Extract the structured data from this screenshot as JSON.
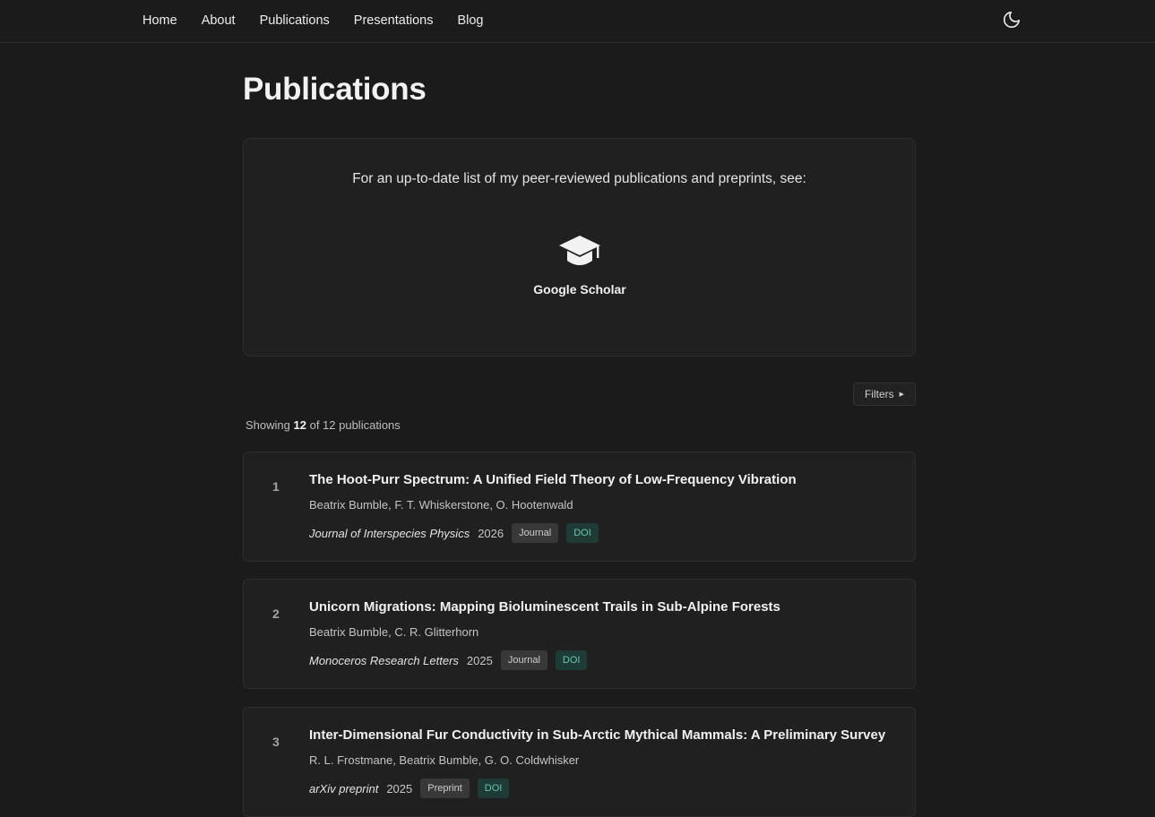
{
  "nav": {
    "items": [
      {
        "label": "Home"
      },
      {
        "label": "About"
      },
      {
        "label": "Publications"
      },
      {
        "label": "Presentations"
      },
      {
        "label": "Blog"
      }
    ],
    "theme_icon": "moon-icon"
  },
  "page": {
    "title": "Publications"
  },
  "scholar": {
    "text": "For an up-to-date list of my peer-reviewed publications and preprints, see:",
    "icon": "graduation-cap-icon",
    "label": "Google Scholar"
  },
  "filters": {
    "label": "Filters",
    "icon": "caret-right-icon"
  },
  "summary": {
    "prefix": "Showing",
    "shown": "12",
    "middle": "of 12 publications"
  },
  "publications": [
    {
      "number": "1",
      "title": "The Hoot-Purr Spectrum: A Unified Field Theory of Low-Frequency Vibration",
      "authors": "Beatrix Bumble, F. T. Whiskerstone, O. Hootenwald",
      "venue": "Journal of Interspecies Physics",
      "year": "2026",
      "type": "Journal",
      "doi_label": "DOI"
    },
    {
      "number": "2",
      "title": "Unicorn Migrations: Mapping Bioluminescent Trails in Sub-Alpine Forests",
      "authors": "Beatrix Bumble, C. R. Glitterhorn",
      "venue": "Monoceros Research Letters",
      "year": "2025",
      "type": "Journal",
      "doi_label": "DOI"
    },
    {
      "number": "3",
      "title": "Inter-Dimensional Fur Conductivity in Sub-Arctic Mythical Mammals: A Preliminary Survey",
      "authors": "R. L. Frostmane, Beatrix Bumble, G. O. Coldwhisker",
      "venue": "arXiv preprint",
      "year": "2025",
      "type": "Preprint",
      "doi_label": "DOI"
    }
  ],
  "colors": {
    "background": "#1b1b1b",
    "card": "#202020",
    "doi_bg": "#1e3b36",
    "doi_text": "#67c4ae"
  }
}
